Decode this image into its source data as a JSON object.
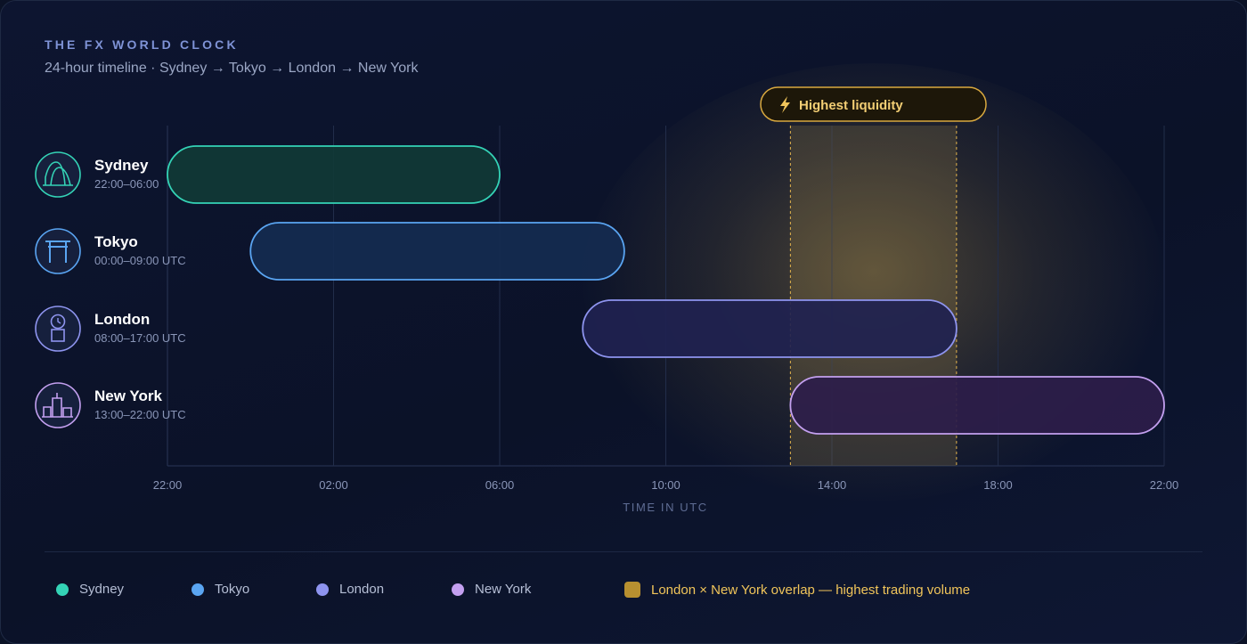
{
  "header": {
    "eyebrow": "THE FX WORLD CLOCK",
    "subtitle": "24-hour timeline · Sydney → Tokyo → London → New York"
  },
  "chart_data": {
    "type": "gantt",
    "x_unit": "hours (UTC)",
    "x_range": [
      "22:00",
      "22:00"
    ],
    "xlabel": "TIME IN UTC",
    "ticks": [
      "22:00",
      "02:00",
      "06:00",
      "10:00",
      "14:00",
      "18:00",
      "22:00"
    ],
    "sessions": [
      {
        "name": "Sydney",
        "label": "22:00–06:00",
        "start": "22:00",
        "end": "06:00",
        "stroke": "#34d3b6",
        "fill": "#113a36",
        "icon": "opera-house-icon"
      },
      {
        "name": "Tokyo",
        "label": "00:00–09:00 UTC",
        "start": "00:00",
        "end": "09:00",
        "stroke": "#5aa5f2",
        "fill": "#152b50",
        "icon": "torii-gate-icon"
      },
      {
        "name": "London",
        "label": "08:00–17:00 UTC",
        "start": "08:00",
        "end": "17:00",
        "stroke": "#8e94ef",
        "fill": "#1f2250",
        "icon": "big-ben-icon"
      },
      {
        "name": "New York",
        "label": "13:00–22:00 UTC",
        "start": "13:00",
        "end": "22:00",
        "stroke": "#c4a0f0",
        "fill": "#2d1d4a",
        "icon": "skyline-icon"
      }
    ],
    "highlight": {
      "start": "13:00",
      "end": "17:00",
      "label": "Highest liquidity",
      "color": "#f1c55a"
    },
    "grid": true
  },
  "legend": {
    "items": [
      {
        "label": "Sydney",
        "color": "#34d3b6"
      },
      {
        "label": "Tokyo",
        "color": "#5aa5f2"
      },
      {
        "label": "London",
        "color": "#8e94ef"
      },
      {
        "label": "New York",
        "color": "#c4a0f0"
      }
    ],
    "overlap_label": "London × New York overlap — highest trading volume",
    "overlap_color": "#b89030"
  }
}
